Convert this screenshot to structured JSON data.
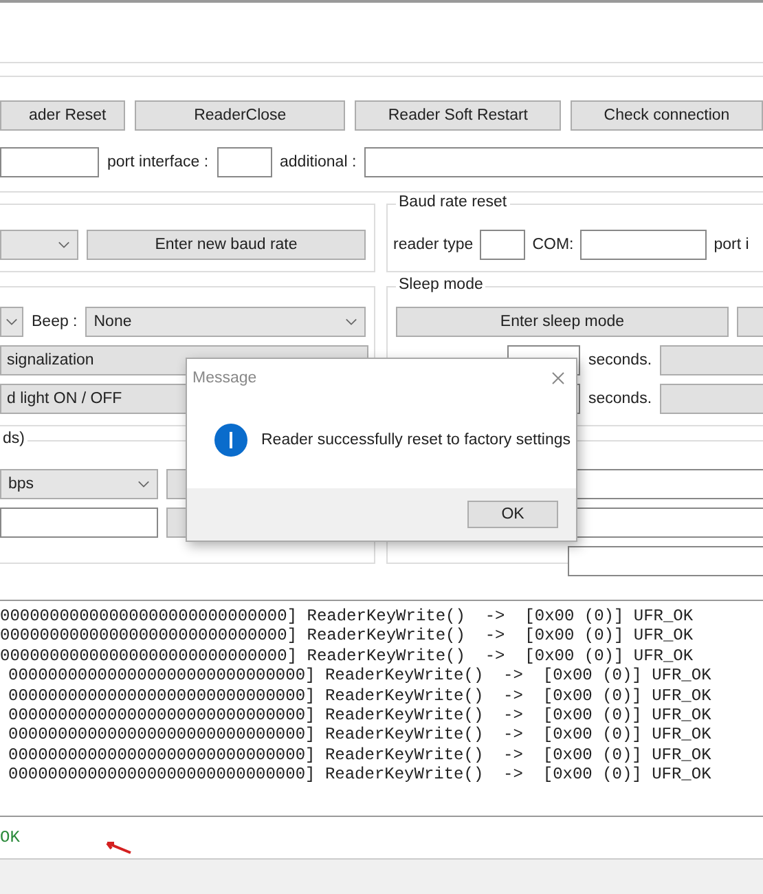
{
  "toolbar_buttons": [
    "ader Reset",
    "ReaderClose",
    "Reader Soft Restart",
    "Check connection"
  ],
  "connection": {
    "port_interface_label": "port interface :",
    "additional_label": "additional :"
  },
  "baud_rate": {
    "button": "Enter new baud rate"
  },
  "baud_rate_reset": {
    "title": "Baud rate reset",
    "reader_type_label": "reader type",
    "com_label": "COM:",
    "port_label": "port i"
  },
  "signal": {
    "beep_label": "Beep :",
    "beep_value": "None",
    "buttons": [
      "signalization",
      "d light ON / OFF"
    ]
  },
  "sleep_mode": {
    "title": "Sleep mode",
    "button": "Enter sleep mode",
    "rows": [
      {
        "unit": "seconds."
      },
      {
        "unit": "seconds."
      }
    ]
  },
  "speed": {
    "title": "ds)",
    "value": "bps"
  },
  "log": {
    "lines": [
      "00000000000000000000000000000] ReaderKeyWrite()  ->  [0x00 (0)] UFR_OK",
      "00000000000000000000000000000] ReaderKeyWrite()  ->  [0x00 (0)] UFR_OK",
      "00000000000000000000000000000] ReaderKeyWrite()  ->  [0x00 (0)] UFR_OK",
      "000000000000000000000000000000] ReaderKeyWrite()  ->  [0x00 (0)] UFR_OK",
      "000000000000000000000000000000] ReaderKeyWrite()  ->  [0x00 (0)] UFR_OK",
      "000000000000000000000000000000] ReaderKeyWrite()  ->  [0x00 (0)] UFR_OK",
      "000000000000000000000000000000] ReaderKeyWrite()  ->  [0x00 (0)] UFR_OK",
      "000000000000000000000000000000] ReaderKeyWrite()  ->  [0x00 (0)] UFR_OK",
      "000000000000000000000000000000] ReaderKeyWrite()  ->  [0x00 (0)] UFR_OK"
    ]
  },
  "status": {
    "text": "OK"
  },
  "dialog": {
    "title": "Message",
    "message": "Reader successfully reset to factory settings",
    "button": "OK"
  }
}
